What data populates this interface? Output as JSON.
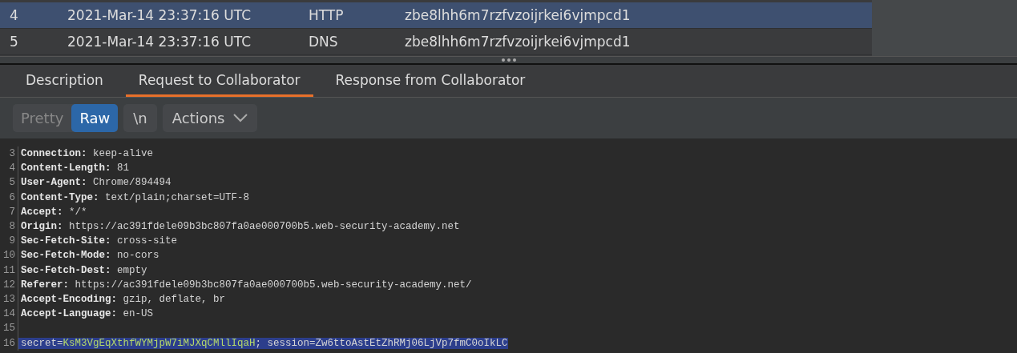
{
  "table": {
    "rows": [
      {
        "number": "4",
        "time": "2021-Mar-14 23:37:16 UTC",
        "type": "HTTP",
        "payload": "zbe8lhh6m7rzfvzoijrkei6vjmpcd1",
        "selected": true
      },
      {
        "number": "5",
        "time": "2021-Mar-14 23:37:16 UTC",
        "type": "DNS",
        "payload": "zbe8lhh6m7rzfvzoijrkei6vjmpcd1",
        "selected": false
      }
    ]
  },
  "tabs": [
    {
      "label": "Description",
      "selected": false
    },
    {
      "label": "Request to Collaborator",
      "selected": true
    },
    {
      "label": "Response from Collaborator",
      "selected": false
    }
  ],
  "view_modes": [
    {
      "label": "Pretty",
      "selected": false
    },
    {
      "label": "Raw",
      "selected": true
    }
  ],
  "newline_button": "\\n",
  "actions_button": "Actions",
  "code_lines": [
    {
      "number": "3",
      "segments": [
        {
          "kind": "key",
          "text": "Connection:"
        },
        {
          "kind": "plain",
          "text": " keep-alive"
        }
      ]
    },
    {
      "number": "4",
      "segments": [
        {
          "kind": "key",
          "text": "Content-Length:"
        },
        {
          "kind": "plain",
          "text": " 81"
        }
      ]
    },
    {
      "number": "5",
      "segments": [
        {
          "kind": "key",
          "text": "User-Agent:"
        },
        {
          "kind": "plain",
          "text": " Chrome/894494"
        }
      ]
    },
    {
      "number": "6",
      "segments": [
        {
          "kind": "key",
          "text": "Content-Type:"
        },
        {
          "kind": "plain",
          "text": " text/plain;charset=UTF-8"
        }
      ]
    },
    {
      "number": "7",
      "segments": [
        {
          "kind": "key",
          "text": "Accept:"
        },
        {
          "kind": "plain",
          "text": " */*"
        }
      ]
    },
    {
      "number": "8",
      "segments": [
        {
          "kind": "key",
          "text": "Origin:"
        },
        {
          "kind": "plain",
          "text": " https://ac391fdele09b3bc807fa0ae000700b5.web-security-academy.net"
        }
      ]
    },
    {
      "number": "9",
      "segments": [
        {
          "kind": "key",
          "text": "Sec-Fetch-Site:"
        },
        {
          "kind": "plain",
          "text": " cross-site"
        }
      ]
    },
    {
      "number": "10",
      "segments": [
        {
          "kind": "key",
          "text": "Sec-Fetch-Mode:"
        },
        {
          "kind": "plain",
          "text": " no-cors"
        }
      ]
    },
    {
      "number": "11",
      "segments": [
        {
          "kind": "key",
          "text": "Sec-Fetch-Dest:"
        },
        {
          "kind": "plain",
          "text": " empty"
        }
      ]
    },
    {
      "number": "12",
      "segments": [
        {
          "kind": "key",
          "text": "Referer:"
        },
        {
          "kind": "plain",
          "text": " https://ac391fdele09b3bc807fa0ae000700b5.web-security-academy.net/"
        }
      ]
    },
    {
      "number": "13",
      "segments": [
        {
          "kind": "key",
          "text": "Accept-Encoding:"
        },
        {
          "kind": "plain",
          "text": " gzip, deflate, br"
        }
      ]
    },
    {
      "number": "14",
      "segments": [
        {
          "kind": "key",
          "text": "Accept-Language:"
        },
        {
          "kind": "plain",
          "text": " en-US"
        }
      ]
    },
    {
      "number": "15"
    },
    {
      "number": "16",
      "selected": true,
      "segments": [
        {
          "kind": "plain",
          "text": "secret="
        },
        {
          "kind": "value",
          "text": "KsM3VgEqXthfWYMjpW7iMJXqCMllIqaH"
        },
        {
          "kind": "plain",
          "text": "; session=Zw6ttoAstEtZhRMj06LjVp7fmC0oIkLC"
        }
      ]
    }
  ]
}
